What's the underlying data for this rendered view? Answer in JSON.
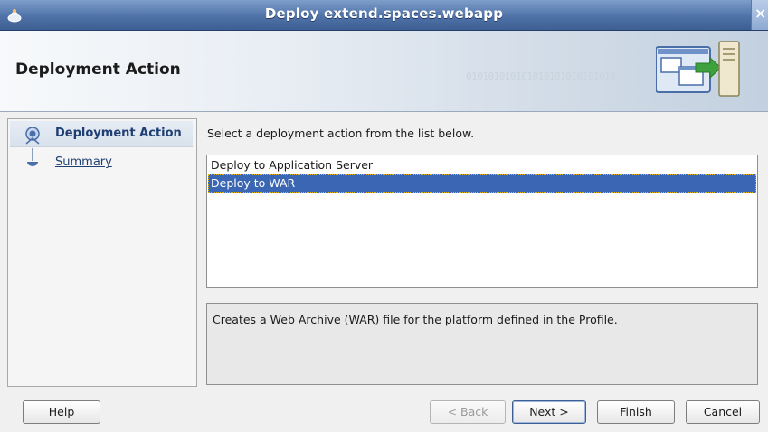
{
  "window": {
    "title": "Deploy extend.spaces.webapp",
    "close_symbol": "×"
  },
  "header": {
    "title": "Deployment Action",
    "watermark": "010101010101010101010101010"
  },
  "nav": {
    "items": [
      {
        "label": "Deployment Action",
        "state": "current"
      },
      {
        "label": "Summary",
        "state": "link"
      }
    ]
  },
  "main": {
    "instruction": "Select a deployment action from the list below.",
    "actions": [
      {
        "label": "Deploy to Application Server",
        "selected": false
      },
      {
        "label": "Deploy to WAR",
        "selected": true
      }
    ],
    "description": "Creates a Web Archive (WAR) file for the platform defined in the Profile."
  },
  "buttons": {
    "help": "Help",
    "back": "< Back",
    "next": "Next >",
    "finish": "Finish",
    "cancel": "Cancel"
  },
  "colors": {
    "title_bar": "#4f72a8",
    "selection": "#3a66b3",
    "nav_text": "#1f3f73"
  }
}
